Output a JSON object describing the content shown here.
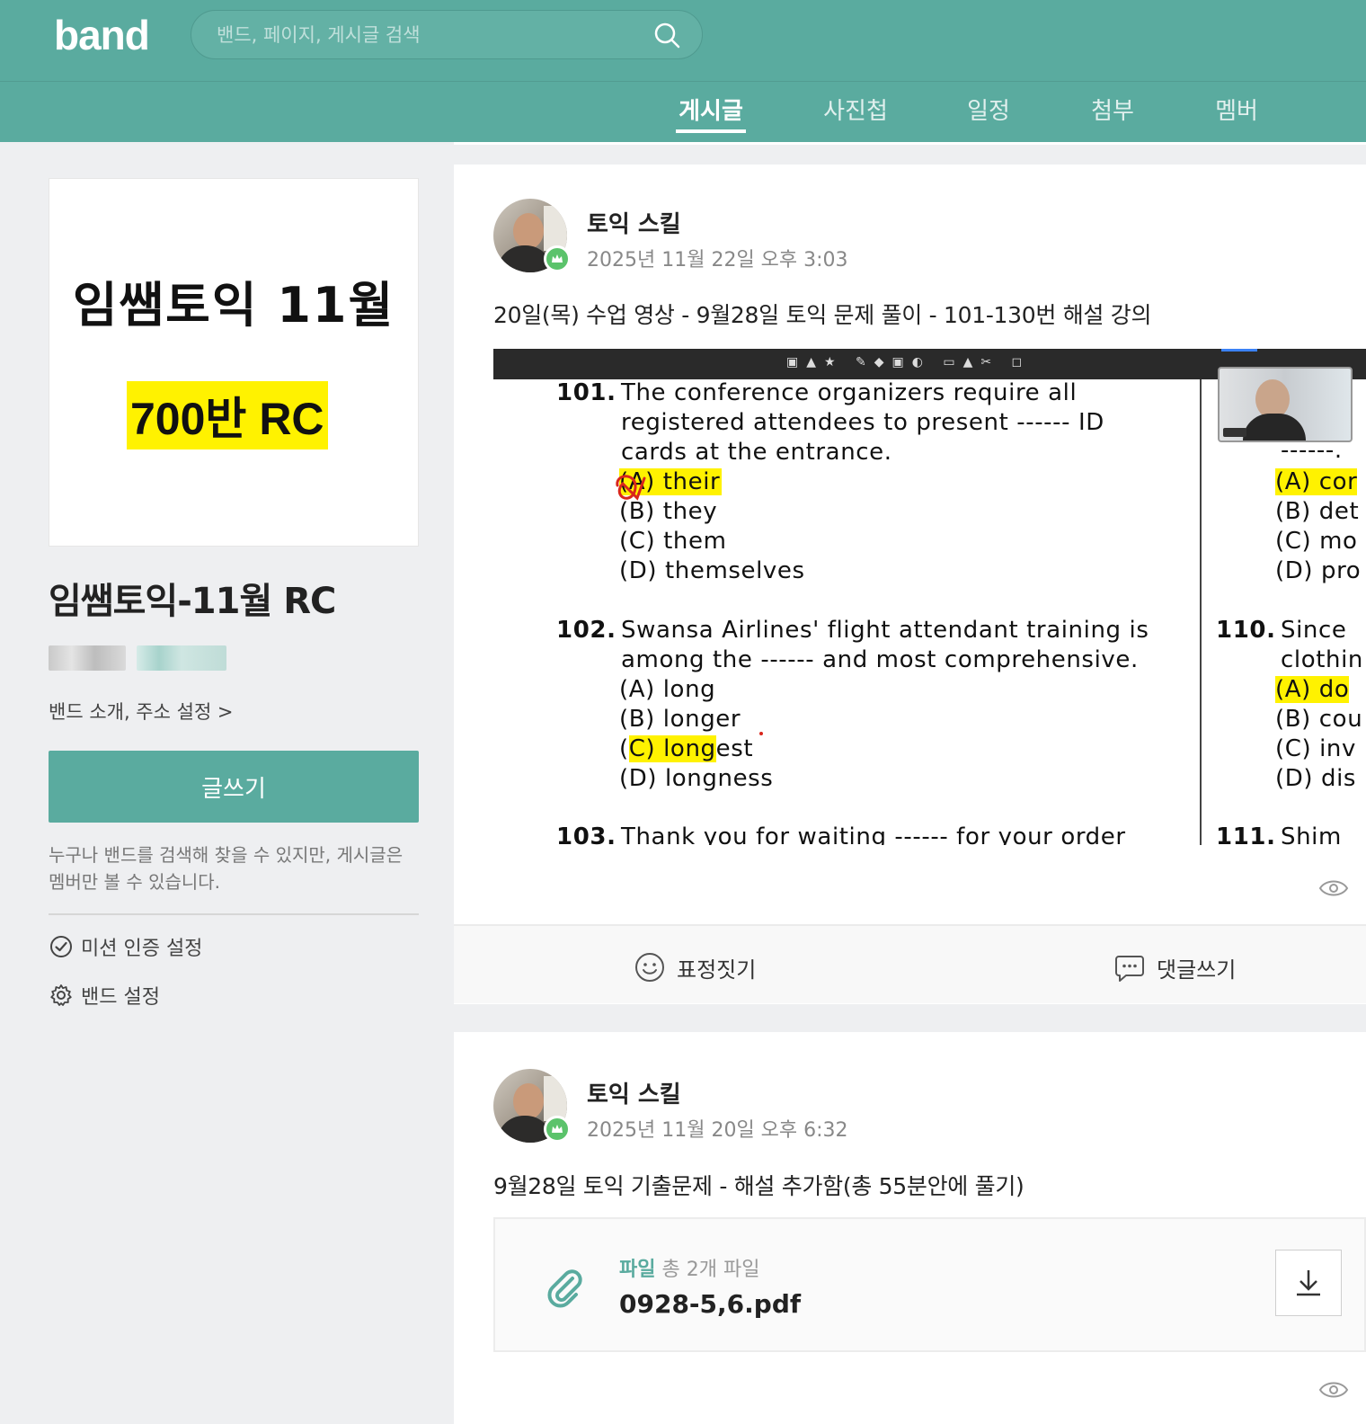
{
  "header": {
    "logo": "band",
    "search_placeholder": "밴드, 페이지, 게시글 검색"
  },
  "tabs": [
    {
      "label": "게시글",
      "active": true
    },
    {
      "label": "사진첩",
      "active": false
    },
    {
      "label": "일정",
      "active": false
    },
    {
      "label": "첨부",
      "active": false
    },
    {
      "label": "멤버",
      "active": false
    }
  ],
  "sidebar": {
    "cover_line1": "임쌤토익 11월",
    "cover_line2": "700반 RC",
    "band_name": "임쌤토익-11월 RC",
    "info_link": "밴드 소개, 주소 설정 >",
    "write_button": "글쓰기",
    "privacy_note": "누구나 밴드를 검색해 찾을 수 있지만, 게시글은 멤버만 볼 수 있습니다.",
    "mission_link": "미션 인증 설정",
    "settings_link": "밴드 설정"
  },
  "posts": [
    {
      "author": "토익 스킬",
      "date": "2025년 11월 22일 오후 3:03",
      "text": "20일(목) 수업 영상 - 9월28일 토익 문제 풀이 - 101-130번 해설 강의",
      "video": {
        "q101_num": "101.",
        "q101_l1": "The conference organizers require all",
        "q101_l2": "registered attendees to present ------ ID",
        "q101_l3": "cards at the entrance.",
        "q101_a": "(A) their",
        "q101_b": "(B) they",
        "q101_c": "(C) them",
        "q101_d": "(D) themselves",
        "q102_num": "102.",
        "q102_l1": "Swansa Airlines' flight attendant training is",
        "q102_l2": "among the ------ and most comprehensive.",
        "q102_a": "(A) long",
        "q102_b": "(B) longer",
        "q102_c_open": "(",
        "q102_c_hl": "C) long",
        "q102_c_rest": "est",
        "q102_d": "(D) longness",
        "q103_num": "103.",
        "q103_l1": "Thank you for waiting ------ for your order",
        "r_dash": "------.",
        "r_a": "(A) cor",
        "r_b": "(B) det",
        "r_c": "(C) mo",
        "r_d": "(D) pro",
        "q110_num": "110.",
        "q110_l1": "Since",
        "q110_l2": "clothin",
        "r2_a": "(A) do",
        "r2_b": "(B) cou",
        "r2_c": "(C) inv",
        "r2_d": "(D) dis",
        "q111_num": "111.",
        "q111_l1": "Shim"
      },
      "actions": {
        "react": "표정짓기",
        "comment": "댓글쓰기"
      }
    },
    {
      "author": "토익 스킬",
      "date": "2025년 11월 20일 오후 6:32",
      "text": "9월28일 토익 기출문제 - 해설 추가함(총 55분안에 풀기)",
      "file": {
        "label": "파일",
        "count": "총 2개 파일",
        "name": "0928-5,6.pdf"
      }
    }
  ],
  "colors": {
    "brand": "#5aab9f",
    "highlight": "#fff200",
    "badge": "#5bc36b"
  }
}
